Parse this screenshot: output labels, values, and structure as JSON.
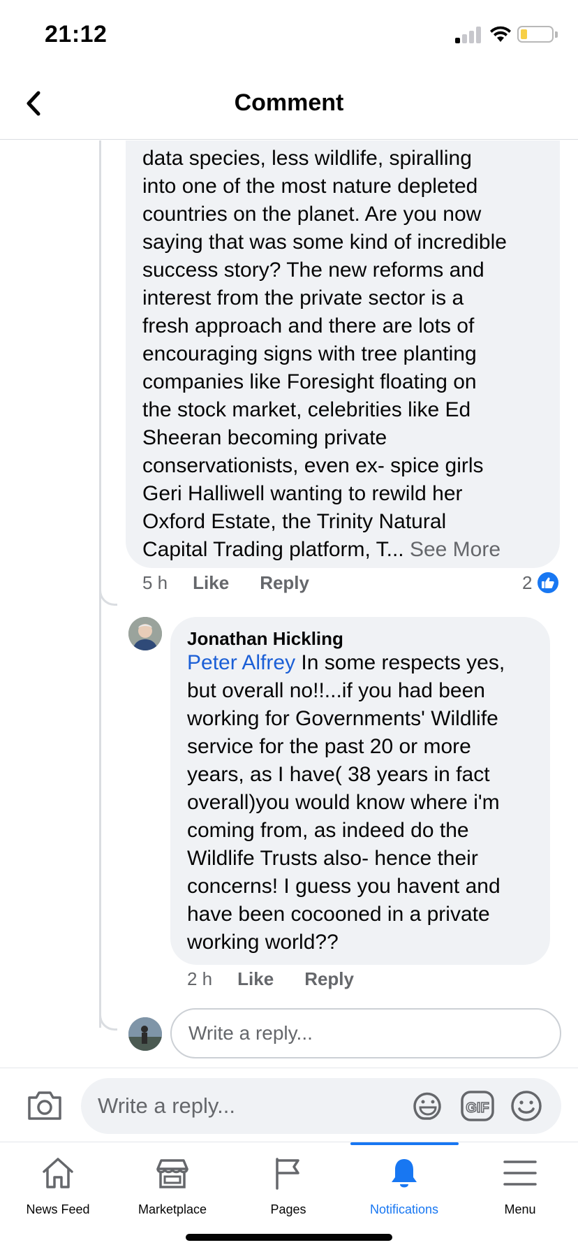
{
  "status_bar": {
    "time": "21:12",
    "battery_color": "#f7cf46"
  },
  "header": {
    "title": "Comment",
    "back_icon": "chevron-left-icon"
  },
  "comments": [
    {
      "body": "data species, less wildlife, spiralling\ninto one of the most nature depleted\ncountries on the planet. Are you now\nsaying that was some kind of incredible\nsuccess story? The new reforms and\ninterest from the private sector is a\nfresh approach and there are lots of\nencouraging signs with tree planting\ncompanies like Foresight floating on\nthe stock market, celebrities like Ed\nSheeran becoming private\nconservationists, even ex- spice girls\nGeri Halliwell wanting to rewild her\nOxford Estate, the Trinity Natural\nCapital Trading platform,  T... ",
      "see_more": "See More",
      "time": "5 h",
      "like_label": "Like",
      "reply_label": "Reply",
      "reaction_count": "2"
    },
    {
      "author": "Jonathan Hickling",
      "mention": "Peter Alfrey",
      "body": " In some respects yes,\nbut overall no!!...if you had been\nworking for Governments' Wildlife\nservice for the past 20 or more\nyears, as I have( 38 years in fact\noverall)you  would know where i'm\ncoming from, as indeed do the\nWildlife Trusts also- hence their\nconcerns! I guess you havent and\nhave been cocooned in a private\nworking world??",
      "time": "2 h",
      "like_label": "Like",
      "reply_label": "Reply"
    }
  ],
  "reply_box": {
    "placeholder": "Write a reply..."
  },
  "composer": {
    "placeholder": "Write a reply...",
    "gif_label": "GIF"
  },
  "tabs": [
    {
      "label": "News Feed",
      "icon": "home-icon",
      "active": false
    },
    {
      "label": "Marketplace",
      "icon": "shop-icon",
      "active": false
    },
    {
      "label": "Pages",
      "icon": "flag-icon",
      "active": false
    },
    {
      "label": "Notifications",
      "icon": "bell-icon",
      "active": true
    },
    {
      "label": "Menu",
      "icon": "hamburger-icon",
      "active": false
    }
  ],
  "colors": {
    "accent": "#1877f2",
    "mention": "#1b5fd6",
    "bubble": "#f0f2f5",
    "secondary_text": "#65676b"
  }
}
